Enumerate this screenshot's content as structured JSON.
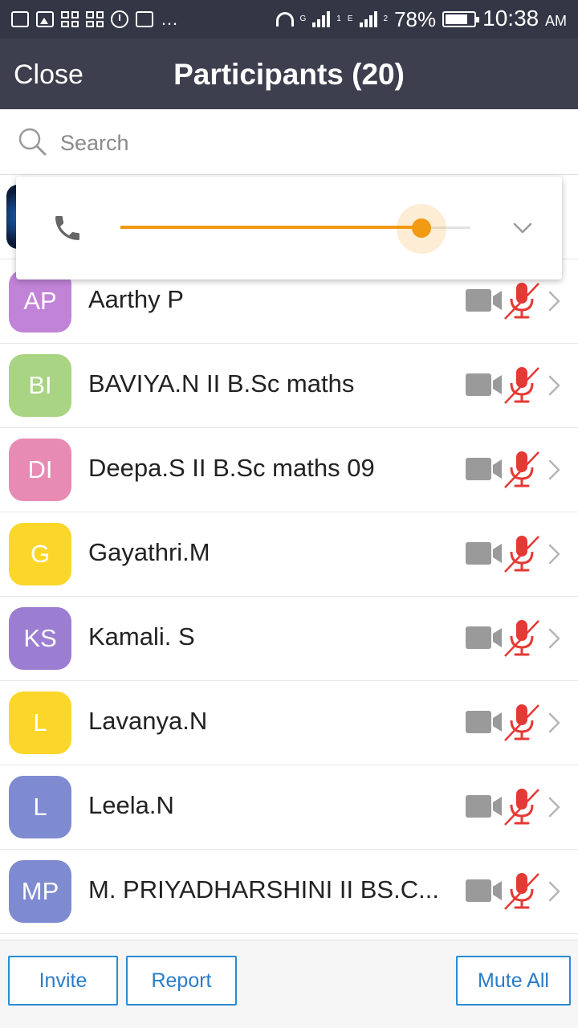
{
  "status_bar": {
    "battery_percent": "78%",
    "battery_level": 0.78,
    "time": "10:38",
    "ampm": "AM",
    "more": "…",
    "sim1_tag": "G",
    "sim1_index": "1",
    "sim2_tag": "E",
    "sim2_index": "2"
  },
  "header": {
    "close_label": "Close",
    "title": "Participants (20)"
  },
  "search": {
    "placeholder": "Search",
    "value": ""
  },
  "audio_popup": {
    "volume_level": 0.86,
    "accent_color": "#f19a12"
  },
  "participants": [
    {
      "initials": "AP",
      "name": "Aarthy P",
      "color": "#c183d8"
    },
    {
      "initials": "BI",
      "name": "BAVIYA.N II B.Sc maths",
      "color": "#a9d483"
    },
    {
      "initials": "DI",
      "name": "Deepa.S II B.Sc maths 09",
      "color": "#e78bb4"
    },
    {
      "initials": "G",
      "name": "Gayathri.M",
      "color": "#fcd72a"
    },
    {
      "initials": "KS",
      "name": "Kamali. S",
      "color": "#9b7ed1"
    },
    {
      "initials": "L",
      "name": "Lavanya.N",
      "color": "#fcd72a"
    },
    {
      "initials": "L",
      "name": "Leela.N",
      "color": "#7f8bd0"
    },
    {
      "initials": "MP",
      "name": "M. PRIYADHARSHINI II BS.C...",
      "color": "#7f8bd0"
    }
  ],
  "participant_status": {
    "video": "off",
    "audio": "muted",
    "muted_color": "#e53935"
  },
  "bottom_bar": {
    "invite_label": "Invite",
    "report_label": "Report",
    "mute_all_label": "Mute All",
    "button_color": "#2a8bd4"
  }
}
